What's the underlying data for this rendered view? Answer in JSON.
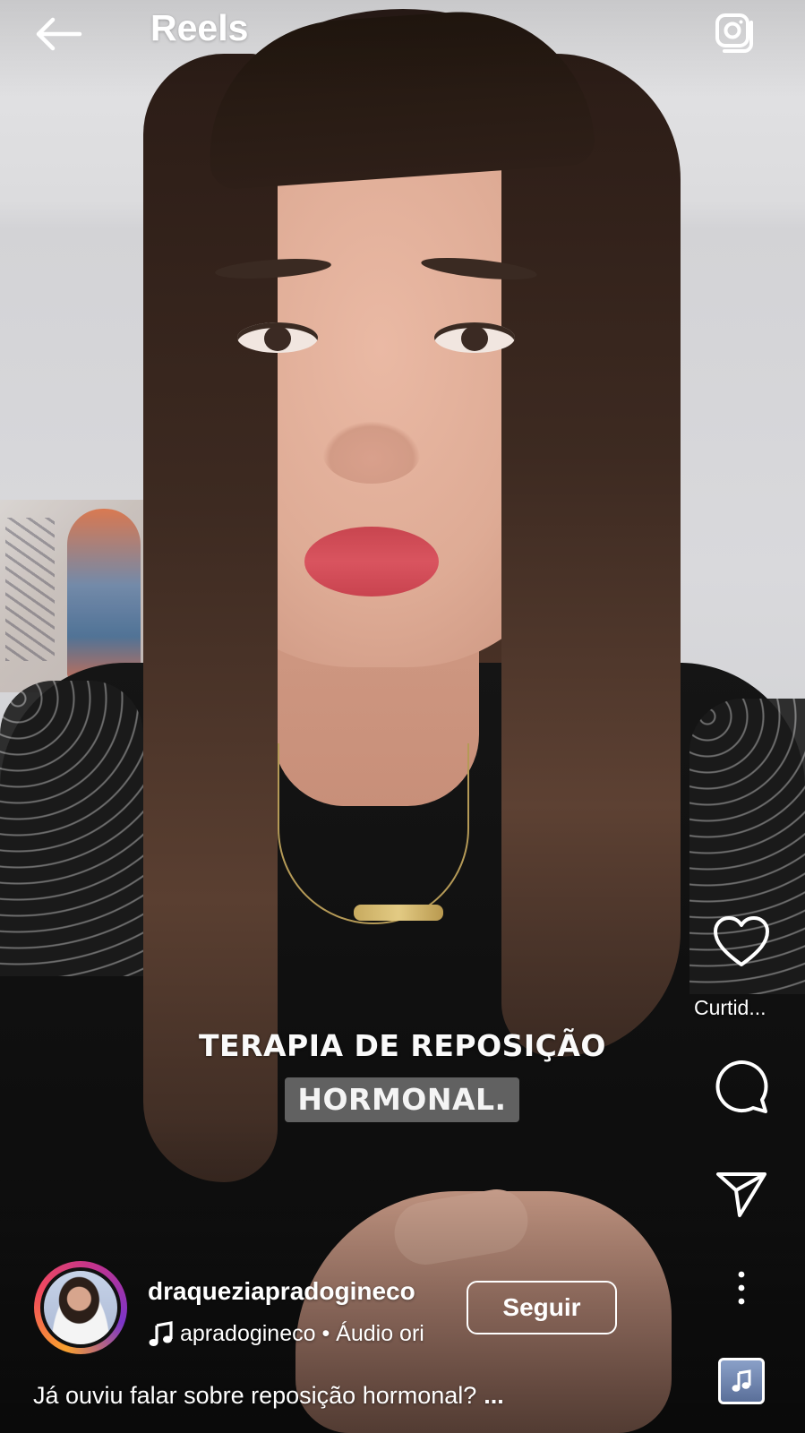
{
  "header": {
    "title": "Reels",
    "back_icon": "arrow-left-icon",
    "camera_icon": "camera-icon"
  },
  "video": {
    "caption_line1": "TERAPIA DE REPOSIÇÃO",
    "caption_line2": "HORMONAL."
  },
  "actions": {
    "like_icon": "heart-icon",
    "like_label": "Curtid...",
    "comment_icon": "comment-icon",
    "share_icon": "send-icon",
    "more_icon": "more-vertical-icon",
    "audio_thumb_icon": "music-note-icon"
  },
  "author": {
    "username": "draqueziapradogineco",
    "follow_label": "Seguir",
    "audio_label": "apradogineco • Áudio ori",
    "music_icon": "music-note-icon"
  },
  "post": {
    "caption": "Já ouviu falar sobre reposição hormonal?",
    "more_label": "..."
  },
  "colors": {
    "story_ring": [
      "#f9a12e",
      "#f14a5d",
      "#c1338f",
      "#7b35c9"
    ],
    "caption_highlight": "#787878",
    "text": "#ffffff"
  }
}
